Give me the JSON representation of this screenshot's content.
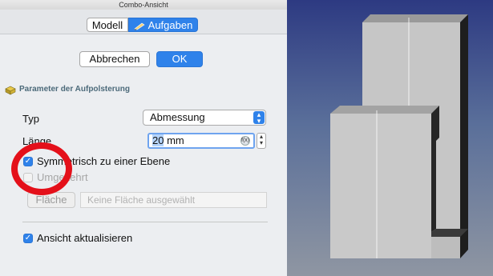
{
  "window": {
    "title": "Combo-Ansicht"
  },
  "tabs": [
    {
      "label": "Modell",
      "active": false
    },
    {
      "label": "Aufgaben",
      "active": true,
      "icon": "tasks-icon"
    }
  ],
  "actions": {
    "cancel_label": "Abbrechen",
    "ok_label": "OK"
  },
  "section": {
    "title": "Parameter der Aufpolsterung",
    "icon": "pad-icon"
  },
  "form": {
    "typ_label": "Typ",
    "typ_value": "Abmessung",
    "length_label": "Länge",
    "length_number": "20",
    "length_unit": " mm",
    "symmetric_label": "Symmetrisch zu einer Ebene",
    "symmetric_checked": true,
    "reversed_label": "Umgekehrt",
    "reversed_checked": false,
    "reversed_enabled": false,
    "face_button_label": "Fläche",
    "face_placeholder": "Keine Fläche ausgewählt",
    "update_view_label": "Ansicht aktualisieren",
    "update_view_checked": true
  },
  "colors": {
    "accent": "#2f82ea",
    "annotation_circle": "#e4101a",
    "viewport_top": "#2d3a82",
    "model_face": "#c8c8c8"
  }
}
